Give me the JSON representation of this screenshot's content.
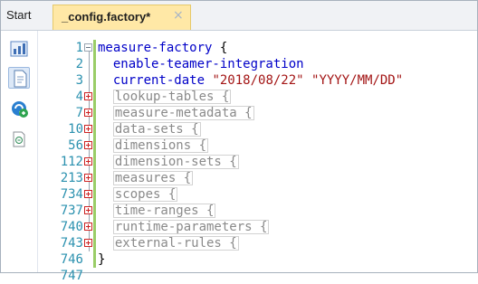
{
  "tabs": {
    "start_label": "Start",
    "active_label": "_config.factory*",
    "close_glyph": "×"
  },
  "toolbar": {
    "tools": [
      {
        "icon": "bar-chart-icon",
        "selected": false
      },
      {
        "icon": "document-icon",
        "selected": true
      },
      {
        "icon": "refresh-green-icon",
        "selected": false
      },
      {
        "icon": "import-icon",
        "selected": false
      }
    ]
  },
  "editor": {
    "lines": [
      {
        "num": "1",
        "fold": "open",
        "tokens": [
          {
            "t": "kw",
            "v": "measure-factory "
          },
          {
            "t": "brace",
            "v": "{"
          }
        ]
      },
      {
        "num": "2",
        "fold": "none",
        "tokens": [
          {
            "t": "kw",
            "v": "  enable-teamer-integration"
          }
        ]
      },
      {
        "num": "3",
        "fold": "none",
        "tokens": [
          {
            "t": "kw",
            "v": "  current-date "
          },
          {
            "t": "str",
            "v": "\"2018/08/22\" \"YYYY/MM/DD\""
          }
        ]
      },
      {
        "num": "4",
        "fold": "plus",
        "tokens": [
          {
            "t": "pad",
            "v": "  "
          },
          {
            "t": "coll",
            "v": "lookup-tables {"
          }
        ]
      },
      {
        "num": "7",
        "fold": "plus",
        "tokens": [
          {
            "t": "pad",
            "v": "  "
          },
          {
            "t": "coll",
            "v": "measure-metadata {"
          }
        ]
      },
      {
        "num": "10",
        "fold": "plus",
        "tokens": [
          {
            "t": "pad",
            "v": "  "
          },
          {
            "t": "coll",
            "v": "data-sets {"
          }
        ]
      },
      {
        "num": "56",
        "fold": "plus",
        "tokens": [
          {
            "t": "pad",
            "v": "  "
          },
          {
            "t": "coll",
            "v": "dimensions {"
          }
        ]
      },
      {
        "num": "112",
        "fold": "plus",
        "tokens": [
          {
            "t": "pad",
            "v": "  "
          },
          {
            "t": "coll",
            "v": "dimension-sets {"
          }
        ]
      },
      {
        "num": "213",
        "fold": "plus",
        "tokens": [
          {
            "t": "pad",
            "v": "  "
          },
          {
            "t": "coll",
            "v": "measures {"
          }
        ]
      },
      {
        "num": "734",
        "fold": "plus",
        "tokens": [
          {
            "t": "pad",
            "v": "  "
          },
          {
            "t": "coll",
            "v": "scopes {"
          }
        ]
      },
      {
        "num": "737",
        "fold": "plus",
        "tokens": [
          {
            "t": "pad",
            "v": "  "
          },
          {
            "t": "coll",
            "v": "time-ranges {"
          }
        ]
      },
      {
        "num": "740",
        "fold": "plus",
        "tokens": [
          {
            "t": "pad",
            "v": "  "
          },
          {
            "t": "coll",
            "v": "runtime-parameters {"
          }
        ]
      },
      {
        "num": "743",
        "fold": "plus",
        "tokens": [
          {
            "t": "pad",
            "v": "  "
          },
          {
            "t": "coll",
            "v": "external-rules {"
          }
        ]
      },
      {
        "num": "746",
        "fold": "end",
        "tokens": [
          {
            "t": "brace",
            "v": "}"
          }
        ]
      },
      {
        "num": "747",
        "fold": "none",
        "tokens": []
      }
    ]
  }
}
